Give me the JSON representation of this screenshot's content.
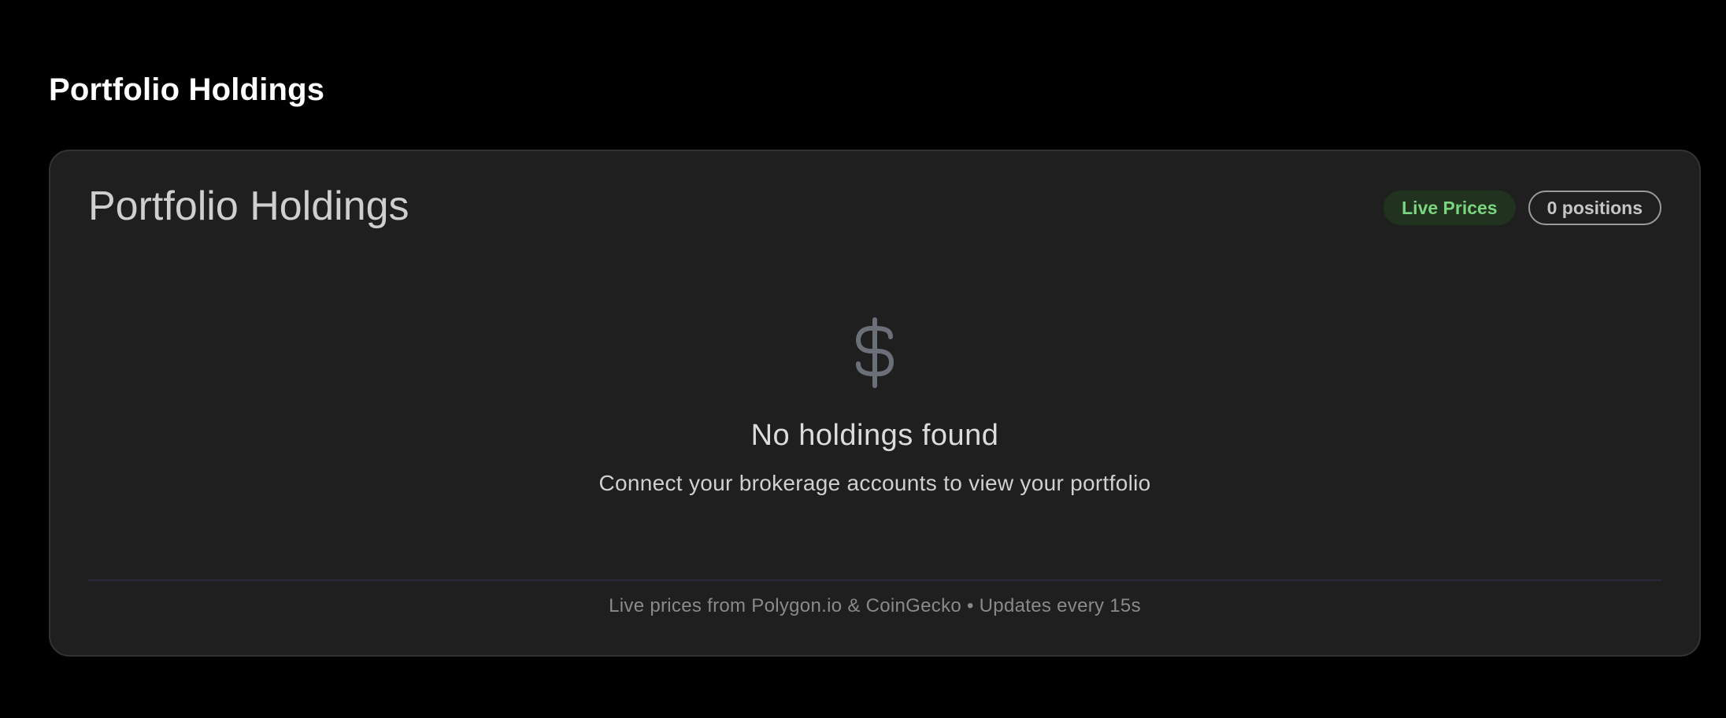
{
  "page": {
    "heading": "Portfolio Holdings"
  },
  "card": {
    "title": "Portfolio Holdings",
    "badges": {
      "live": "Live Prices",
      "positions": "0 positions"
    },
    "empty_state": {
      "icon": "dollar-icon",
      "title": "No holdings found",
      "subtitle": "Connect your brokerage accounts to view your portfolio"
    },
    "footer": "Live prices from Polygon.io & CoinGecko • Updates every 15s"
  },
  "colors": {
    "background": "#000000",
    "card": "#1f1f1f",
    "live_badge_bg": "#21331f",
    "live_badge_text": "#7bd47f",
    "icon": "#6b6f78"
  }
}
